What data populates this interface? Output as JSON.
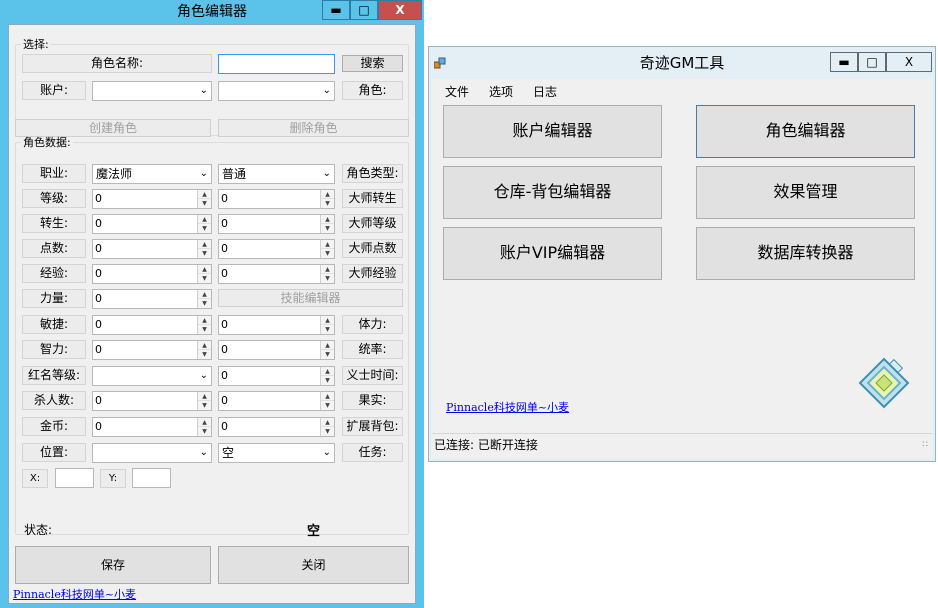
{
  "role_editor": {
    "title": "角色编辑器",
    "controls": {
      "minimize": "▬",
      "maximize": "□",
      "close": "X"
    },
    "select_group": {
      "label": "选择:",
      "role_name_label": "角色名称:",
      "role_name_value": "",
      "search_button": "搜索",
      "account_label": "账户:",
      "account_value": "",
      "role_combo_value": "",
      "role_label": "角色:"
    },
    "create_button": "创建角色",
    "delete_button": "删除角色",
    "data_group": {
      "label": "角色数据:",
      "class_label": "职业:",
      "class_value": "魔法师",
      "type_value": "普通",
      "type_label": "角色类型:",
      "level_label": "等级:",
      "level_value": "0",
      "master_rebirth_value": "0",
      "master_rebirth_label": "大师转生",
      "rebirth_label": "转生:",
      "rebirth_value": "0",
      "master_level_value": "0",
      "master_level_label": "大师等级",
      "points_label": "点数:",
      "points_value": "0",
      "master_points_value": "0",
      "master_points_label": "大师点数",
      "exp_label": "经验:",
      "exp_value": "0",
      "master_exp_value": "0",
      "master_exp_label": "大师经验",
      "strength_label": "力量:",
      "strength_value": "0",
      "skill_editor_button": "技能编辑器",
      "agility_label": "敏捷:",
      "agility_value": "0",
      "stamina_value": "0",
      "stamina_label": "体力:",
      "intelligence_label": "智力:",
      "intelligence_value": "0",
      "command_value": "0",
      "command_label": "统率:",
      "pk_level_label": "红名等级:",
      "pk_level_value": "",
      "hero_time_value": "0",
      "hero_time_label": "义士时间:",
      "kills_label": "杀人数:",
      "kills_value": "0",
      "fruit_value": "0",
      "fruit_label": "果实:",
      "gold_label": "金币:",
      "gold_value": "0",
      "ext_bag_value": "0",
      "ext_bag_label": "扩展背包:",
      "location_label": "位置:",
      "location_value": "",
      "quest_value": "空",
      "quest_label": "任务:",
      "x_label": "X:",
      "x_value": "",
      "y_label": "Y:",
      "y_value": ""
    },
    "status_label": "状态:",
    "status_value": "空",
    "save_button": "保存",
    "close_button": "关闭",
    "footer_link": "Pinnacle科技网单~小麦"
  },
  "gm_tool": {
    "title": "奇迹GM工具",
    "controls": {
      "minimize": "▬",
      "maximize": "□",
      "close": "X"
    },
    "menu": [
      "文件",
      "选项",
      "日志"
    ],
    "buttons": {
      "account_editor": "账户编辑器",
      "role_editor": "角色编辑器",
      "warehouse_editor": "仓库-背包编辑器",
      "effect_manager": "效果管理",
      "vip_editor": "账户VIP编辑器",
      "db_converter": "数据库转换器"
    },
    "footer_link": "Pinnacle科技网单~小麦",
    "status_text": "已连接: 已断开连接"
  }
}
